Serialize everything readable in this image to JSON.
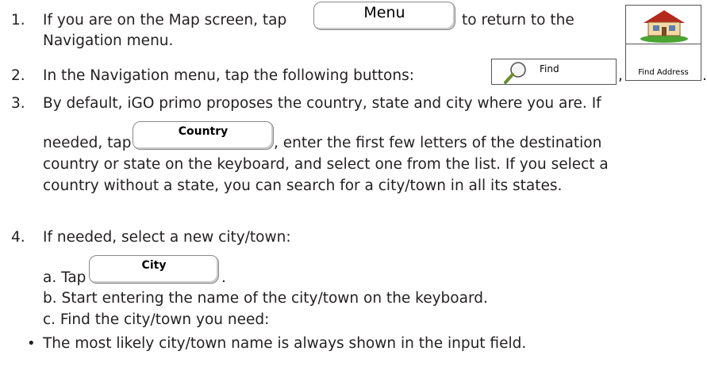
{
  "steps": {
    "n1": "1.",
    "s1_pre": "If you are on the Map screen, tap",
    "s1_button": "Menu",
    "s1_post": "to return to the",
    "s1_line2": "Navigation menu.",
    "n2": "2.",
    "s2_text": "In the Navigation menu, tap the following buttons:",
    "s2_find": "Find",
    "s2_sep": ",",
    "s2_find_address": "Find Address",
    "s2_end": ".",
    "n3": "3.",
    "s3_line1": "By default, iGO primo proposes the country, state and city where you are. If",
    "s3_pre": "needed, tap",
    "s3_button": "Country",
    "s3_post": ", enter the first few letters of the destination",
    "s3_line3": "country or state on the keyboard, and select one from the list. If you select a",
    "s3_line4": "country without a state, you can search for a city/town in all its states.",
    "n4": "4.",
    "s4_line1": "If needed, select a new city/town:",
    "s4a_pre": "a. Tap",
    "s4a_button": "City",
    "s4a_end": ".",
    "s4b": "b. Start entering the name of the city/town on the keyboard.",
    "s4c": "c. Find the city/town you need:",
    "bullet": "•",
    "bullet1": "The most likely city/town name is always shown in the input field."
  },
  "icons": {
    "find": "magnifier-icon",
    "find_address": "house-icon"
  }
}
